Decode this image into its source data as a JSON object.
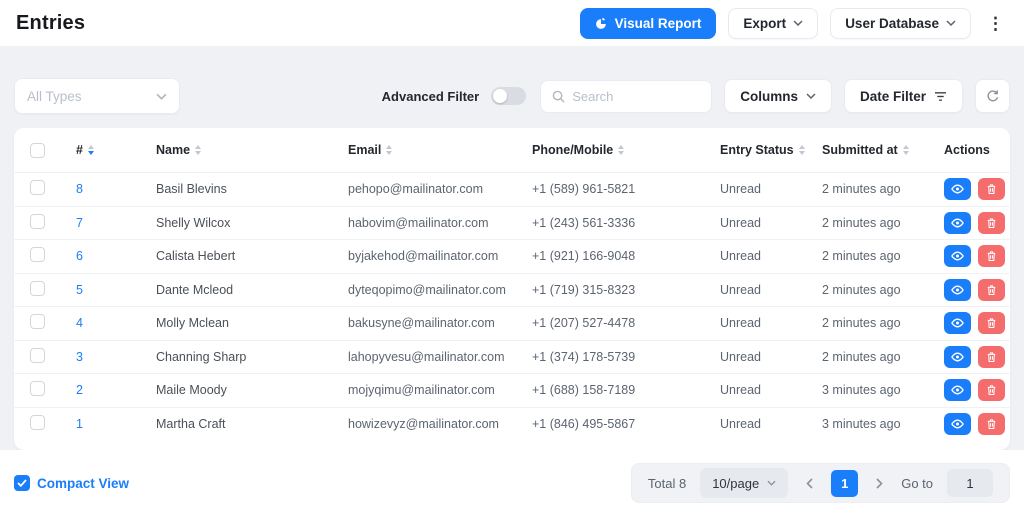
{
  "header": {
    "title": "Entries",
    "buttons": {
      "visual_report": "Visual Report",
      "export": "Export",
      "user_database": "User Database"
    }
  },
  "icons": {
    "more_menu_glyph": "⋮"
  },
  "filter_bar": {
    "type_filter": {
      "placeholder": "All Types",
      "value": ""
    },
    "advanced_filter": {
      "label": "Advanced Filter",
      "enabled": false
    },
    "search": {
      "placeholder": "Search",
      "value": ""
    },
    "columns_button": "Columns",
    "date_filter_button": "Date Filter"
  },
  "table": {
    "sort": {
      "column": "#",
      "direction": "desc"
    },
    "columns": [
      {
        "label": "#"
      },
      {
        "label": "Name"
      },
      {
        "label": "Email"
      },
      {
        "label": "Phone/Mobile"
      },
      {
        "label": "Entry Status"
      },
      {
        "label": "Submitted at"
      },
      {
        "label": "Actions"
      }
    ],
    "rows": [
      {
        "serial": "8",
        "name": "Basil Blevins",
        "email": "pehopo@mailinator.com",
        "phone": "+1 (589) 961-5821",
        "status": "Unread",
        "submitted_at": "2 minutes ago"
      },
      {
        "serial": "7",
        "name": "Shelly Wilcox",
        "email": "habovim@mailinator.com",
        "phone": "+1 (243) 561-3336",
        "status": "Unread",
        "submitted_at": "2 minutes ago"
      },
      {
        "serial": "6",
        "name": "Calista Hebert",
        "email": "byjakehod@mailinator.com",
        "phone": "+1 (921) 166-9048",
        "status": "Unread",
        "submitted_at": "2 minutes ago"
      },
      {
        "serial": "5",
        "name": "Dante Mcleod",
        "email": "dyteqopimo@mailinator.com",
        "phone": "+1 (719) 315-8323",
        "status": "Unread",
        "submitted_at": "2 minutes ago"
      },
      {
        "serial": "4",
        "name": "Molly Mclean",
        "email": "bakusyne@mailinator.com",
        "phone": "+1 (207) 527-4478",
        "status": "Unread",
        "submitted_at": "2 minutes ago"
      },
      {
        "serial": "3",
        "name": "Channing Sharp",
        "email": "lahopyvesu@mailinator.com",
        "phone": "+1 (374) 178-5739",
        "status": "Unread",
        "submitted_at": "2 minutes ago"
      },
      {
        "serial": "2",
        "name": "Maile Moody",
        "email": "mojyqimu@mailinator.com",
        "phone": "+1 (688) 158-7189",
        "status": "Unread",
        "submitted_at": "3 minutes ago"
      },
      {
        "serial": "1",
        "name": "Martha Craft",
        "email": "howizevyz@mailinator.com",
        "phone": "+1 (846) 495-5867",
        "status": "Unread",
        "submitted_at": "3 minutes ago"
      }
    ]
  },
  "footer": {
    "compact_view": {
      "label": "Compact View",
      "checked": true
    },
    "pagination": {
      "total_label": "Total 8",
      "per_page": "10/page",
      "current_page": "1",
      "goto_label": "Go to",
      "goto_value": "1"
    }
  },
  "colors": {
    "primary": "#1a7efb",
    "danger": "#f56c6c",
    "page_background": "#f0f1f4",
    "card_background": "#ffffff",
    "text_dark": "#23272e",
    "text_muted": "#5c6470",
    "placeholder": "#b9bfca"
  }
}
